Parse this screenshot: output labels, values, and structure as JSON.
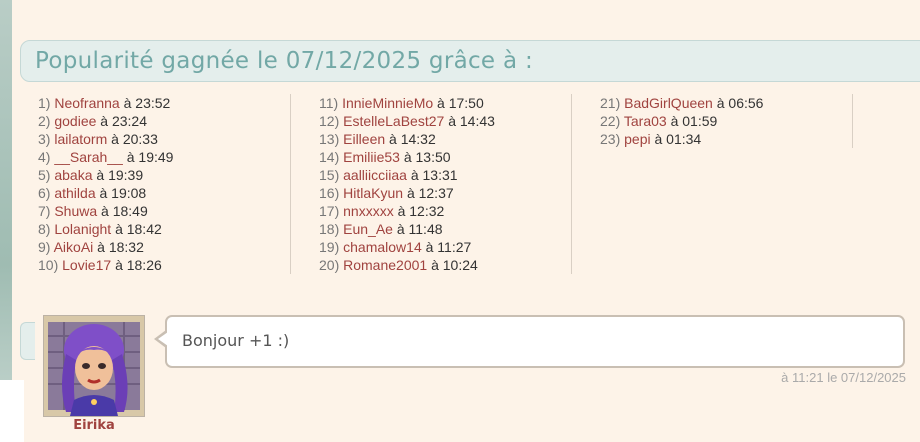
{
  "header": {
    "title": "Popularité gagnée le 07/12/2025 grâce à :"
  },
  "popularity": {
    "col1": [
      {
        "num": "1)",
        "user": "Neofranna",
        "time": "à 23:52"
      },
      {
        "num": "2)",
        "user": "godiee",
        "time": "à 23:24"
      },
      {
        "num": "3)",
        "user": "lailatorm",
        "time": "à 20:33"
      },
      {
        "num": "4)",
        "user": "__Sarah__",
        "time": "à 19:49"
      },
      {
        "num": "5)",
        "user": "abaka",
        "time": "à 19:39"
      },
      {
        "num": "6)",
        "user": "athilda",
        "time": "à 19:08"
      },
      {
        "num": "7)",
        "user": "Shuwa",
        "time": "à 18:49"
      },
      {
        "num": "8)",
        "user": "Lolanight",
        "time": "à 18:42"
      },
      {
        "num": "9)",
        "user": "AikoAi",
        "time": "à 18:32"
      },
      {
        "num": "10)",
        "user": "Lovie17",
        "time": "à 18:26"
      }
    ],
    "col2": [
      {
        "num": "11)",
        "user": "InnieMinnieMo",
        "time": "à 17:50"
      },
      {
        "num": "12)",
        "user": "EstelleLaBest27",
        "time": "à 14:43"
      },
      {
        "num": "13)",
        "user": "Eilleen",
        "time": "à 14:32"
      },
      {
        "num": "14)",
        "user": "Emiliie53",
        "time": "à 13:50"
      },
      {
        "num": "15)",
        "user": "aalliicciiaa",
        "time": "à 13:31"
      },
      {
        "num": "16)",
        "user": "HitlaKyun",
        "time": "à 12:37"
      },
      {
        "num": "17)",
        "user": "nnxxxxx",
        "time": "à 12:32"
      },
      {
        "num": "18)",
        "user": "Eun_Ae",
        "time": "à 11:48"
      },
      {
        "num": "19)",
        "user": "chamalow14",
        "time": "à 11:27"
      },
      {
        "num": "20)",
        "user": "Romane2001",
        "time": "à 10:24"
      }
    ],
    "col3": [
      {
        "num": "21)",
        "user": "BadGirlQueen",
        "time": "à 06:56"
      },
      {
        "num": "22)",
        "user": "Tara03",
        "time": "à 01:59"
      },
      {
        "num": "23)",
        "user": "pepi",
        "time": "à 01:34"
      }
    ]
  },
  "post": {
    "author": "Eirika",
    "message": "Bonjour +1 :)",
    "timestamp": "à 11:21 le 07/12/2025"
  }
}
